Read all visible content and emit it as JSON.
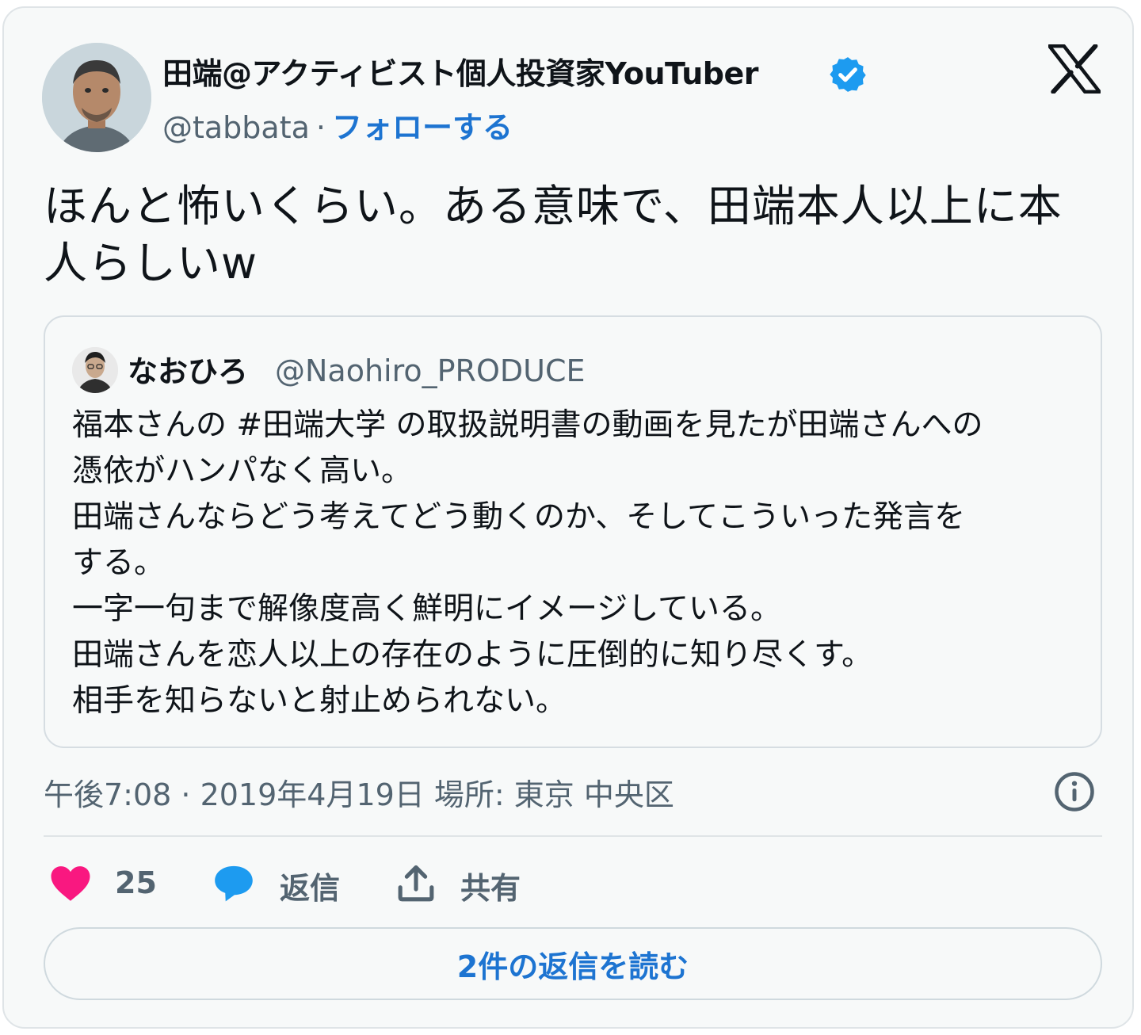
{
  "tweet": {
    "author_name": "田端@アクティビスト個人投資家YouTuber",
    "handle": "@tabbata",
    "separator": "·",
    "follow_label": "フォローする",
    "text_lines": [
      "ほんと怖いくらい。ある意味で、田端本人以上に本",
      "人らしいw"
    ],
    "meta": "午後7:08 · 2019年4月19日 場所: 東京 中央区"
  },
  "quoted_tweet": {
    "author_name": "なおひろ",
    "handle": "@Naohiro_PRODUCE",
    "text_lines": [
      "福本さんの #田端大学 の取扱説明書の動画を見たが田端さんへの",
      "憑依がハンパなく高い。",
      "田端さんならどう考えてどう動くのか、そしてこういった発言を",
      "する。",
      "一字一句まで解像度高く鮮明にイメージしている。",
      "田端さんを恋人以上の存在のように圧倒的に知り尽くす。",
      "相手を知らないと射止められない。"
    ]
  },
  "actions": {
    "like_count": "25",
    "reply_label": "返信",
    "share_label": "共有"
  },
  "read_replies_label": "2件の返信を読む",
  "icons": {
    "verified": "verified-badge-icon",
    "brand": "x-logo-icon",
    "info": "info-icon",
    "like": "heart-icon",
    "reply": "speech-bubble-icon",
    "share": "share-upload-icon"
  },
  "colors": {
    "accent": "#1d74d1",
    "verified": "#1d9bf0",
    "like": "#f91880",
    "reply": "#1d9bf0",
    "secondary_text": "#536471",
    "card_bg": "#f7f9f9"
  }
}
